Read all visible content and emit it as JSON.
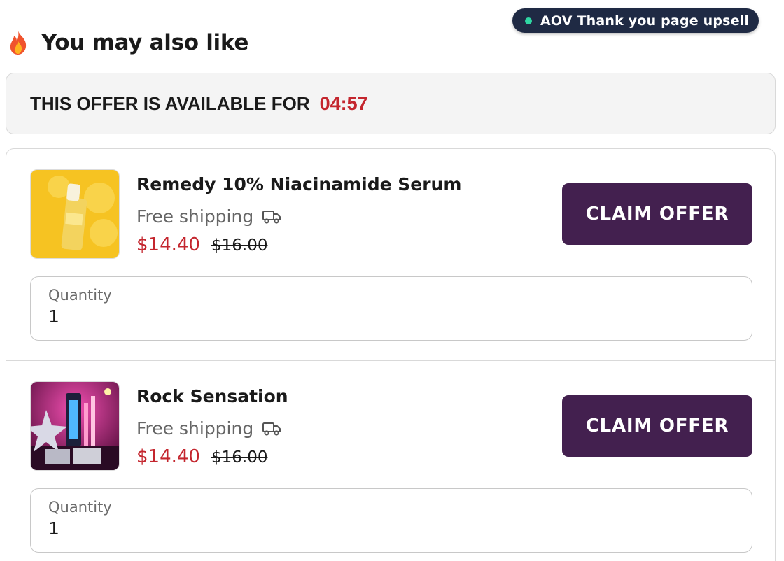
{
  "badge": {
    "label": "AOV Thank you page upsell",
    "dot_color": "#2fd6a3"
  },
  "header": {
    "icon": "fire-icon",
    "title": "You may also like"
  },
  "timer": {
    "label": "THIS OFFER IS AVAILABLE FOR",
    "countdown": "04:57",
    "countdown_color": "#c4262e"
  },
  "offers": [
    {
      "name": "Remedy 10% Niacinamide Serum",
      "shipping": "Free shipping",
      "shipping_icon": "truck-icon",
      "price": "$14.40",
      "compare_price": "$16.00",
      "button": "CLAIM OFFER",
      "quantity_label": "Quantity",
      "quantity_value": "1"
    },
    {
      "name": "Rock Sensation",
      "shipping": "Free shipping",
      "shipping_icon": "truck-icon",
      "price": "$14.40",
      "compare_price": "$16.00",
      "button": "CLAIM OFFER",
      "quantity_label": "Quantity",
      "quantity_value": "1"
    }
  ],
  "colors": {
    "button_bg": "#43204f",
    "sale_price": "#c4262e",
    "badge_bg": "#1f2a44"
  }
}
